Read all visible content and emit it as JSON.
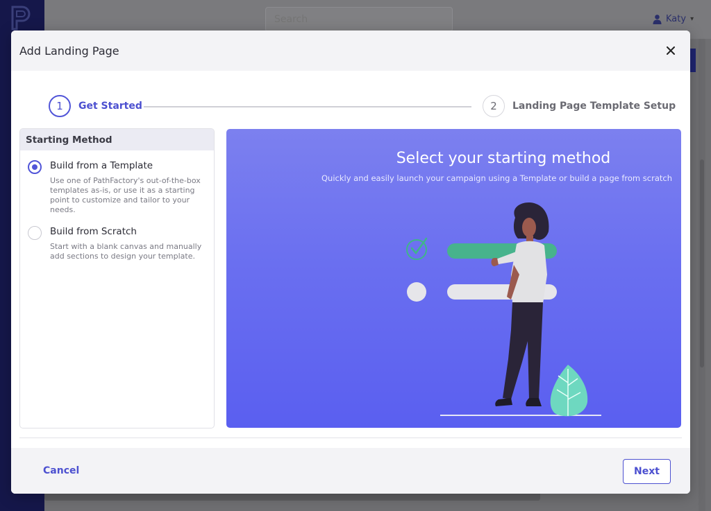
{
  "app": {
    "search_placeholder": "Search",
    "user_name": "Katy"
  },
  "modal": {
    "title": "Add Landing Page"
  },
  "stepper": {
    "steps": [
      {
        "number": "1",
        "label": "Get Started",
        "active": true
      },
      {
        "number": "2",
        "label": "Landing Page Template Setup",
        "active": false
      }
    ]
  },
  "starting_method": {
    "header": "Starting Method",
    "options": [
      {
        "title": "Build from a Template",
        "description": "Use one of PathFactory's out-of-the-box templates as-is, or use it as a starting point to customize and tailor to your needs.",
        "selected": true
      },
      {
        "title": "Build from Scratch",
        "description": "Start with a blank canvas and manually add sections to design your template.",
        "selected": false
      }
    ]
  },
  "preview": {
    "title": "Select your starting method",
    "subtitle": "Quickly and easily launch your campaign using a Template or build a page from scratch"
  },
  "footer": {
    "cancel_label": "Cancel",
    "next_label": "Next"
  },
  "colors": {
    "accent": "#4c50d0",
    "sidebar": "#15174a",
    "preview_top": "#7c80ef",
    "preview_bottom": "#5a5ff0",
    "check_green": "#3fb589"
  },
  "icons": {
    "close": "close-icon",
    "user": "user-icon",
    "chevron": "chevron-down-icon",
    "logo": "pathfactory-logo"
  }
}
